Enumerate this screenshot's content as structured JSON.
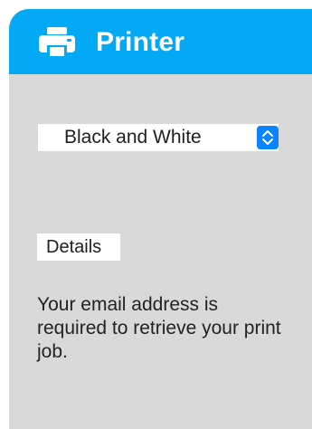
{
  "header": {
    "title": "Printer",
    "icon": "printer-icon",
    "background_color": "#03a9f4"
  },
  "print_mode_select": {
    "value": "Black and White",
    "icon": "up-down-chevron-icon",
    "accent_color": "#0a84ff"
  },
  "details": {
    "label": "Details"
  },
  "info": {
    "text": "Your email address is required to retrieve your print job."
  },
  "colors": {
    "card_background": "#d9d9d9"
  }
}
